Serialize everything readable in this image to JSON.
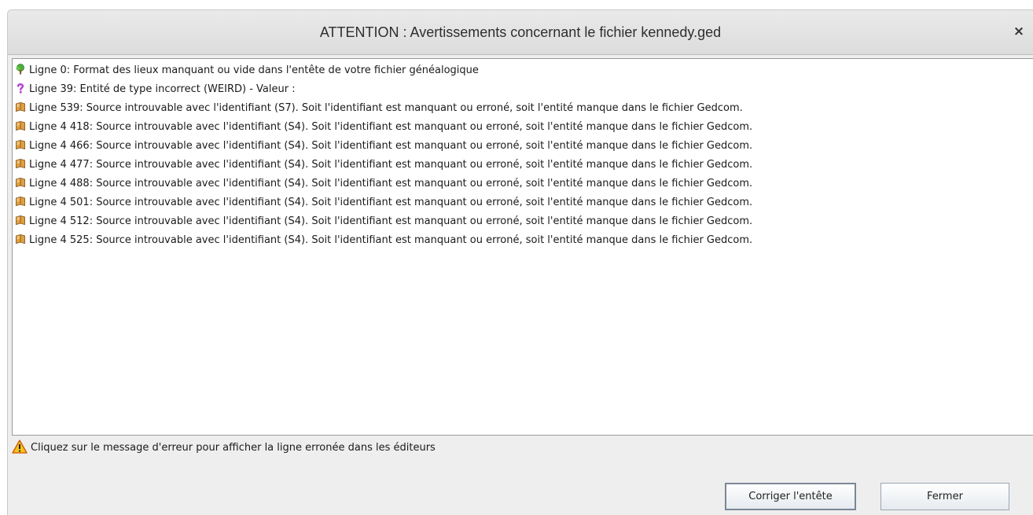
{
  "dialog": {
    "title": "ATTENTION : Avertissements concernant le fichier kennedy.ged",
    "close_glyph": "×"
  },
  "warnings": [
    {
      "icon": "tree-icon",
      "text": "Ligne 0: Format des lieux manquant ou vide dans l'entête de votre fichier généalogique"
    },
    {
      "icon": "question-mark-icon",
      "text": "Ligne 39: Entité de type incorrect (WEIRD) - Valeur :"
    },
    {
      "icon": "book-icon",
      "text": "Ligne 539: Source introuvable avec l'identifiant (S7). Soit l'identifiant est manquant ou erroné, soit l'entité manque dans le fichier Gedcom."
    },
    {
      "icon": "book-icon",
      "text": "Ligne 4 418: Source introuvable avec l'identifiant (S4). Soit l'identifiant est manquant ou erroné, soit l'entité manque dans le fichier Gedcom."
    },
    {
      "icon": "book-icon",
      "text": "Ligne 4 466: Source introuvable avec l'identifiant (S4). Soit l'identifiant est manquant ou erroné, soit l'entité manque dans le fichier Gedcom."
    },
    {
      "icon": "book-icon",
      "text": "Ligne 4 477: Source introuvable avec l'identifiant (S4). Soit l'identifiant est manquant ou erroné, soit l'entité manque dans le fichier Gedcom."
    },
    {
      "icon": "book-icon",
      "text": "Ligne 4 488: Source introuvable avec l'identifiant (S4). Soit l'identifiant est manquant ou erroné, soit l'entité manque dans le fichier Gedcom."
    },
    {
      "icon": "book-icon",
      "text": "Ligne 4 501: Source introuvable avec l'identifiant (S4). Soit l'identifiant est manquant ou erroné, soit l'entité manque dans le fichier Gedcom."
    },
    {
      "icon": "book-icon",
      "text": "Ligne 4 512: Source introuvable avec l'identifiant (S4). Soit l'identifiant est manquant ou erroné, soit l'entité manque dans le fichier Gedcom."
    },
    {
      "icon": "book-icon",
      "text": "Ligne 4 525: Source introuvable avec l'identifiant (S4). Soit l'identifiant est manquant ou erroné, soit l'entité manque dans le fichier Gedcom."
    }
  ],
  "hint": {
    "icon": "warning-icon",
    "text": "Cliquez sur le message d'erreur pour afficher la ligne erronée dans les éditeurs"
  },
  "buttons": {
    "fix_header": "Corriger l'entête",
    "close": "Fermer"
  }
}
